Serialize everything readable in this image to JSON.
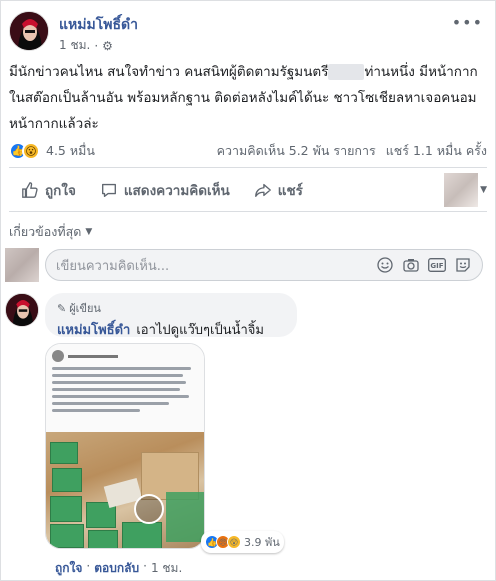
{
  "post": {
    "author": "แหม่มโพธิ์ดำ",
    "time": "1 ชม.",
    "dot": "·",
    "text_before_censor": "มีนักข่าวคนไหน สนใจทำข่าว คนสนิทผู้ติดตามรัฐมนตรี",
    "text_after_censor": "ท่านหนึ่ง มีหน้ากากในสต๊อกเป็นล้านอัน พร้อมหลักฐาน ติดต่อหลังไมค์ได้นะ ชาวโซเชียลหาเจอคนอมหน้ากากแล้วล่ะ",
    "reactions_count": "4.5 หมื่น",
    "comments_count": "ความคิดเห็น 5.2 พัน รายการ",
    "shares_count": "แชร์ 1.1 หมื่น ครั้ง"
  },
  "actions": {
    "like": "ถูกใจ",
    "comment": "แสดงความคิดเห็น",
    "share": "แชร์"
  },
  "sort_label": "เกี่ยวข้องที่สุด",
  "comment_input": {
    "placeholder": "เขียนความคิดเห็น..."
  },
  "comment": {
    "badge": "ผู้เขียน",
    "author": "แหม่มโพธิ์ดำ",
    "text": "เอาไปดูแว๊บๆเป็นน้ำจิ้ม",
    "reactions_count": "3.9 พัน",
    "like_label": "ถูกใจ",
    "reply_label": "ตอบกลับ",
    "time": "1 ชม.",
    "dot": "·"
  },
  "colors": {
    "link": "#385898",
    "like_blue": "#1877f2",
    "wow_yellow": "#f7b928",
    "angry_orange": "#e9710f"
  }
}
